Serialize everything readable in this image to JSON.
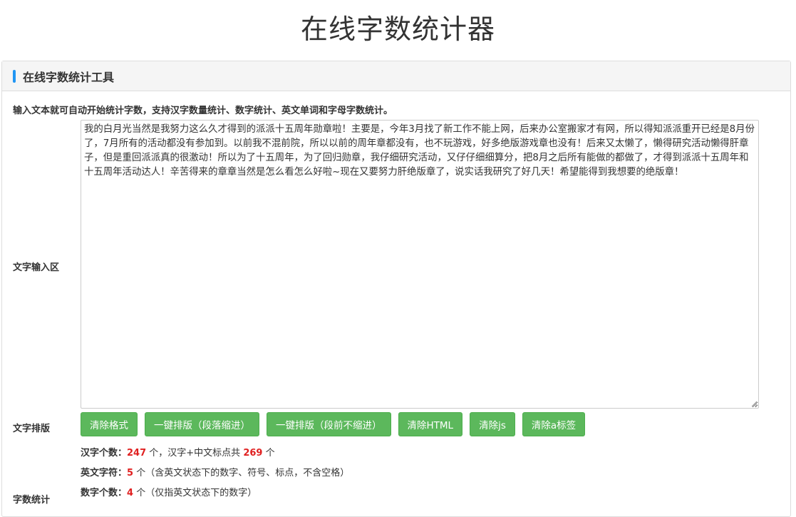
{
  "page": {
    "title": "在线字数统计器"
  },
  "panel": {
    "heading": "在线字数统计工具",
    "intro": "输入文本就可自动开始统计字数，支持汉字数量统计、数字统计、英文单词和字母字数统计。",
    "input_label": "文字输入区",
    "input_text": "我的白月光当然是我努力这么久才得到的派派十五周年勋章啦！主要是，今年3月找了新工作不能上网，后来办公室搬家才有网，所以得知派派重开已经是8月份了，7月所有的活动都没有参加到。以前我不混前院，所以以前的周年章都没有，也不玩游戏，好多绝版游戏章也没有！后来又太懒了，懒得研究活动懒得肝章子，但是重回派派真的很激动！所以为了十五周年，为了回归勋章，我仔细研究活动，又仔仔细细算分，把8月之后所有能做的都做了，才得到派派十五周年和十五周年活动达人！辛苦得来的章章当然是怎么看怎么好啦~现在又要努力肝绝版章了，说实话我研究了好几天！希望能得到我想要的绝版章！",
    "layout_label": "文字排版",
    "stats_label": "字数统计",
    "buttons": {
      "clear_format": "清除格式",
      "layout_indent": "一键排版（段落缩进）",
      "layout_no_indent": "一键排版（段前不缩进）",
      "clear_html": "清除HTML",
      "clear_js": "清除js",
      "clear_a": "清除a标签"
    },
    "stats": {
      "chinese_label": "汉字个数：",
      "chinese_count": "247",
      "chinese_mid": " 个，汉字+中文标点共 ",
      "chinese_total": "269",
      "chinese_suffix": " 个",
      "english_label": "英文字符：",
      "english_count": "5",
      "english_suffix": " 个（含英文状态下的数字、符号、标点，不含空格）",
      "digit_label": "数字个数：",
      "digit_count": "4",
      "digit_suffix": " 个（仅指英文状态下的数字）"
    }
  }
}
